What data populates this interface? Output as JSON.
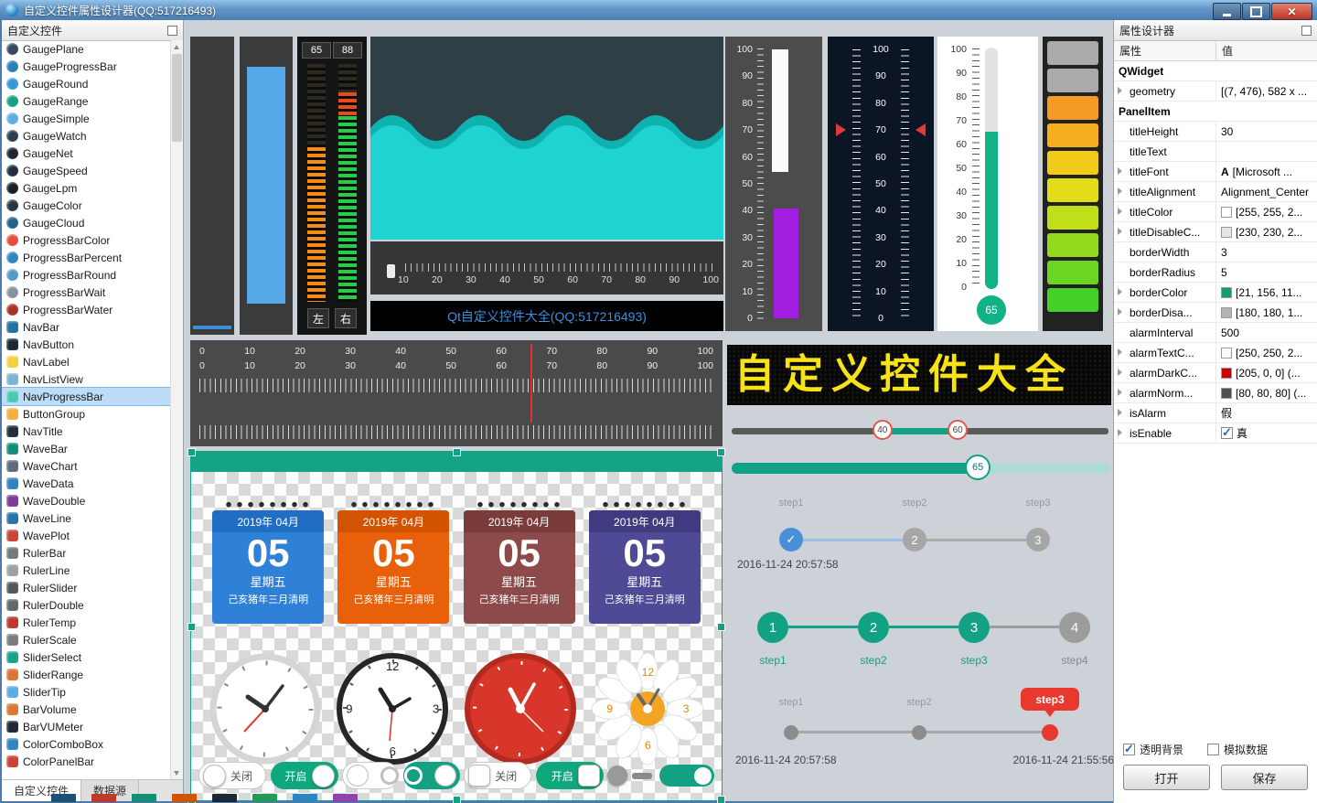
{
  "window": {
    "title": "自定义控件属性设计器(QQ:517216493)"
  },
  "sidebar": {
    "title": "自定义控件",
    "tabs": [
      {
        "label": "自定义控件"
      },
      {
        "label": "数据源"
      }
    ],
    "items": [
      {
        "label": "GaugePlane",
        "color": "#34495e",
        "shape": "ic-round"
      },
      {
        "label": "GaugeProgressBar",
        "color": "#2980b9",
        "shape": "ic-round"
      },
      {
        "label": "GaugeRound",
        "color": "#3498db",
        "shape": "ic-round"
      },
      {
        "label": "GaugeRange",
        "color": "#16a085",
        "shape": "ic-round"
      },
      {
        "label": "GaugeSimple",
        "color": "#5dade2",
        "shape": "ic-round"
      },
      {
        "label": "GaugeWatch",
        "color": "#2c3e50",
        "shape": "ic-round"
      },
      {
        "label": "GaugeNet",
        "color": "#1b2631",
        "shape": "ic-round"
      },
      {
        "label": "GaugeSpeed",
        "color": "#212f3d",
        "shape": "ic-round"
      },
      {
        "label": "GaugeLpm",
        "color": "#17202a",
        "shape": "ic-round"
      },
      {
        "label": "GaugeColor",
        "color": "#273746",
        "shape": "ic-round"
      },
      {
        "label": "GaugeCloud",
        "color": "#21618c",
        "shape": "ic-round"
      },
      {
        "label": "ProgressBarColor",
        "color": "#e74c3c",
        "shape": "ic-round"
      },
      {
        "label": "ProgressBarPercent",
        "color": "#2e86c1",
        "shape": "ic-round"
      },
      {
        "label": "ProgressBarRound",
        "color": "#5499c7",
        "shape": "ic-round"
      },
      {
        "label": "ProgressBarWait",
        "color": "#85929e",
        "shape": "ic-round"
      },
      {
        "label": "ProgressBarWater",
        "color": "#a93226",
        "shape": "ic-round"
      },
      {
        "label": "NavBar",
        "color": "#2471a3",
        "shape": "ic-sq"
      },
      {
        "label": "NavButton",
        "color": "#1c2833",
        "shape": "ic-sq"
      },
      {
        "label": "NavLabel",
        "color": "#f4d03f",
        "shape": "ic-sq"
      },
      {
        "label": "NavListView",
        "color": "#7fb3d5",
        "shape": "ic-sq"
      },
      {
        "label": "NavProgressBar",
        "color": "#48c9b0",
        "shape": "ic-sq",
        "state": "sel"
      },
      {
        "label": "ButtonGroup",
        "color": "#f5b041",
        "shape": "ic-sq"
      },
      {
        "label": "NavTitle",
        "color": "#212f3d",
        "shape": "ic-sq"
      },
      {
        "label": "WaveBar",
        "color": "#148f77",
        "shape": "ic-sq"
      },
      {
        "label": "WaveChart",
        "color": "#5d6d7e",
        "shape": "ic-sq"
      },
      {
        "label": "WaveData",
        "color": "#2e86c1",
        "shape": "ic-sq"
      },
      {
        "label": "WaveDouble",
        "color": "#7d3c98",
        "shape": "ic-sq"
      },
      {
        "label": "WaveLine",
        "color": "#2874a6",
        "shape": "ic-sq"
      },
      {
        "label": "WavePlot",
        "color": "#cb4335",
        "shape": "ic-sq"
      },
      {
        "label": "RulerBar",
        "color": "#707b7c",
        "shape": "ic-sq"
      },
      {
        "label": "RulerLine",
        "color": "#99a3a4",
        "shape": "ic-sq"
      },
      {
        "label": "RulerSlider",
        "color": "#515a5a",
        "shape": "ic-sq"
      },
      {
        "label": "RulerDouble",
        "color": "#616a6b",
        "shape": "ic-sq"
      },
      {
        "label": "RulerTemp",
        "color": "#c0392b",
        "shape": "ic-sq"
      },
      {
        "label": "RulerScale",
        "color": "#7b7d7d",
        "shape": "ic-sq"
      },
      {
        "label": "SliderSelect",
        "color": "#17a589",
        "shape": "ic-sq"
      },
      {
        "label": "SliderRange",
        "color": "#dc7633",
        "shape": "ic-sq"
      },
      {
        "label": "SliderTip",
        "color": "#5dade2",
        "shape": "ic-sq"
      },
      {
        "label": "BarVolume",
        "color": "#dc7633",
        "shape": "ic-sq"
      },
      {
        "label": "BarVUMeter",
        "color": "#1c2833",
        "shape": "ic-sq"
      },
      {
        "label": "ColorComboBox",
        "color": "#2e86c1",
        "shape": "ic-sq"
      },
      {
        "label": "ColorPanelBar",
        "color": "#cb4335",
        "shape": "ic-sq"
      }
    ]
  },
  "canvas": {
    "led_meter": {
      "left_value": "65",
      "right_value": "88",
      "left_label": "左",
      "right_label": "右"
    },
    "caption": "Qt自定义控件大全(QQ:517216493)",
    "led_matrix_text": "自定义控件大全",
    "scale_0_100": [
      "0",
      "10",
      "20",
      "30",
      "40",
      "50",
      "60",
      "70",
      "80",
      "90",
      "100"
    ],
    "scale_100_0": [
      "100",
      "90",
      "80",
      "70",
      "60",
      "50",
      "40",
      "30",
      "20",
      "10",
      "0"
    ],
    "scale_10_100": [
      "10",
      "20",
      "30",
      "40",
      "50",
      "60",
      "70",
      "80",
      "90",
      "100"
    ],
    "thermometer": {
      "value": "65"
    },
    "range_slider": {
      "low": "40",
      "high": "60"
    },
    "progress_slider": {
      "value": "65"
    },
    "led_colors": [
      "#aaaaaa",
      "#aaaaaa",
      "#f59a23",
      "#f5ae1e",
      "#f2cb1a",
      "#e2dd18",
      "#bfdf1b",
      "#93da1f",
      "#6ad523",
      "#44d027"
    ],
    "calendars": [
      {
        "hdr": "#1f6ec4",
        "body": "#2f81d8",
        "title": "2019年 04月",
        "day": "05",
        "week": "星期五",
        "lunar": "己亥猪年三月清明"
      },
      {
        "hdr": "#d35400",
        "body": "#e8610a",
        "title": "2019年 04月",
        "day": "05",
        "week": "星期五",
        "lunar": "己亥猪年三月清明"
      },
      {
        "hdr": "#7a3b3b",
        "body": "#8d4a4a",
        "title": "2019年 04月",
        "day": "05",
        "week": "星期五",
        "lunar": "己亥猪年三月清明"
      },
      {
        "hdr": "#403a80",
        "body": "#4f4a96",
        "title": "2019年 04月",
        "day": "05",
        "week": "星期五",
        "lunar": "己亥猪年三月清明"
      }
    ],
    "clock_nums": {
      "n12": "12",
      "n3": "3",
      "n6": "6",
      "n9": "9"
    },
    "daisy_nums": {
      "n12": "12",
      "n3": "3",
      "n6": "6",
      "n9": "9"
    },
    "toggles": [
      {
        "type": "t-pill-off",
        "label": "关闭"
      },
      {
        "type": "t-pill-on",
        "label": "开启"
      },
      {
        "type": "t-ring-off"
      },
      {
        "type": "t-ring-on"
      },
      {
        "type": "t-sq-off",
        "label": "关闭"
      },
      {
        "type": "t-sq-on",
        "label": "开启"
      },
      {
        "type": "t-knob-off"
      },
      {
        "type": "t-knob-on"
      }
    ],
    "steps1": {
      "labels": [
        "step1",
        "step2",
        "step3"
      ],
      "check": "✓",
      "n2": "2",
      "n3": "3",
      "timestamp": "2016-11-24 20:57:58"
    },
    "steps2": {
      "labels": [
        "step1",
        "step2",
        "step3",
        "step4"
      ],
      "n1": "1",
      "n2": "2",
      "n3": "3",
      "n4": "4"
    },
    "steps3": {
      "l1": "step1",
      "l2": "step2",
      "balloon": "step3",
      "ts_left": "2016-11-24 20:57:58",
      "ts_right": "2016-11-24 21:55:56"
    },
    "bottom_icons": [
      "#1a5276",
      "#c0392b",
      "#148f77",
      "#d35400",
      "#1c2833",
      "#239b56",
      "#2e86c1",
      "#8e44ad"
    ]
  },
  "props": {
    "title": "属性设计器",
    "col_name": "属性",
    "col_value": "值",
    "rows": [
      {
        "name": "QWidget",
        "rowtype": "group"
      },
      {
        "name": "geometry",
        "value": "[(7, 476), 582 x ...",
        "expand": true
      },
      {
        "name": "PanelItem",
        "rowtype": "group"
      },
      {
        "name": "titleHeight",
        "value": "30"
      },
      {
        "name": "titleText",
        "value": ""
      },
      {
        "name": "titleFont",
        "value": "[Microsoft ...",
        "fontIcon": "A",
        "expand": true
      },
      {
        "name": "titleAlignment",
        "value": "Alignment_Center",
        "expand": true
      },
      {
        "name": "titleColor",
        "value": "[255, 255, 2...",
        "swatch": "#ffffff",
        "expand": true
      },
      {
        "name": "titleDisableC...",
        "value": "[230, 230, 2...",
        "swatch": "#e6e6e6",
        "expand": true
      },
      {
        "name": "borderWidth",
        "value": "3"
      },
      {
        "name": "borderRadius",
        "value": "5"
      },
      {
        "name": "borderColor",
        "value": "[21, 156, 11...",
        "swatch": "#159c6f",
        "expand": true
      },
      {
        "name": "borderDisa...",
        "value": "[180, 180, 1...",
        "swatch": "#b4b4b4",
        "expand": true
      },
      {
        "name": "alarmInterval",
        "value": "500"
      },
      {
        "name": "alarmTextC...",
        "value": "[250, 250, 2...",
        "swatch": "#fafafa",
        "expand": true
      },
      {
        "name": "alarmDarkC...",
        "value": "[205, 0, 0] (...",
        "swatch": "#cd0000",
        "expand": true
      },
      {
        "name": "alarmNorm...",
        "value": "[80, 80, 80] (...",
        "swatch": "#505050",
        "expand": true
      },
      {
        "name": "isAlarm",
        "value": "假",
        "expand": true
      },
      {
        "name": "isEnable",
        "value": "真",
        "check": true,
        "expand": true
      }
    ],
    "footer": {
      "cb_transparent": "透明背景",
      "cb_mock": "模拟数据",
      "open_btn": "打开",
      "save_btn": "保存"
    }
  }
}
